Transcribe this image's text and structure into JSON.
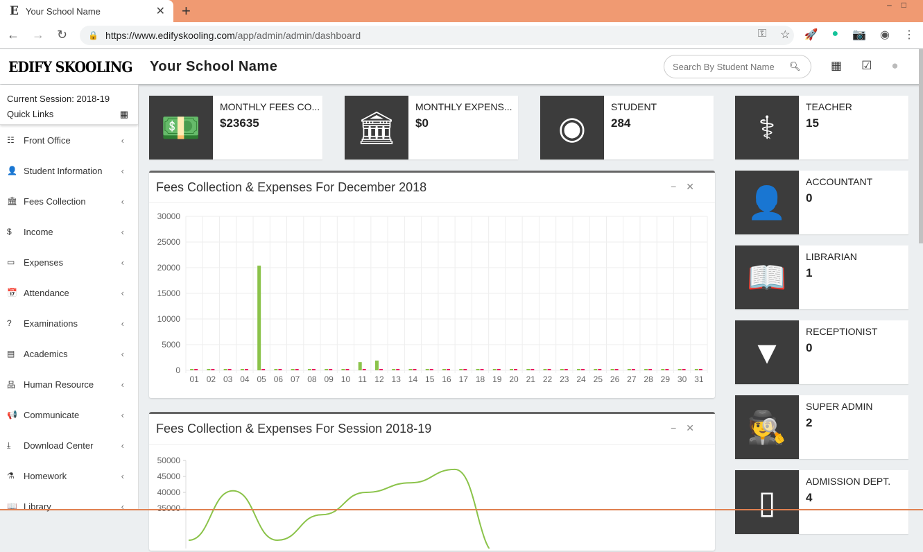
{
  "browser": {
    "tab_title": "Your School Name",
    "tab_logo": "E",
    "url_host": "https://www.edifyskooling.com",
    "url_path": "/app/admin/admin/dashboard",
    "icons": [
      "back-icon",
      "forward-icon",
      "reload-icon",
      "lock-icon",
      "key-icon",
      "star-icon",
      "rocket-icon",
      "grammarly-icon",
      "camera-icon",
      "profile-icon",
      "menu-icon"
    ]
  },
  "header": {
    "brand": "EDIFY SKOOLING",
    "school_name": "Your School Name",
    "search_placeholder": "Search By Student Name",
    "icons": [
      "search-icon",
      "calendar-icon",
      "checkbox-icon",
      "user-icon"
    ]
  },
  "sidebar": {
    "session": "Current Session: 2018-19",
    "quick_links": "Quick Links",
    "items": [
      {
        "label": "Front Office",
        "icon": "building-icon",
        "glyph": "☷"
      },
      {
        "label": "Student Information",
        "icon": "user-plus-icon",
        "glyph": "👤"
      },
      {
        "label": "Fees Collection",
        "icon": "bank-icon",
        "glyph": "🏛"
      },
      {
        "label": "Income",
        "icon": "dollar-icon",
        "glyph": "$"
      },
      {
        "label": "Expenses",
        "icon": "credit-card-icon",
        "glyph": "▭"
      },
      {
        "label": "Attendance",
        "icon": "calendar-check-icon",
        "glyph": "📅"
      },
      {
        "label": "Examinations",
        "icon": "question-icon",
        "glyph": "?"
      },
      {
        "label": "Academics",
        "icon": "id-card-icon",
        "glyph": "▤"
      },
      {
        "label": "Human Resource",
        "icon": "sitemap-icon",
        "glyph": "品"
      },
      {
        "label": "Communicate",
        "icon": "bullhorn-icon",
        "glyph": "📢"
      },
      {
        "label": "Download Center",
        "icon": "download-icon",
        "glyph": "⤓"
      },
      {
        "label": "Homework",
        "icon": "flask-icon",
        "glyph": "⚗"
      },
      {
        "label": "Library",
        "icon": "book-icon",
        "glyph": "📖"
      }
    ]
  },
  "stats": [
    {
      "label": "MONTHLY FEES CO...",
      "value": "$23635",
      "icon": "money-icon",
      "glyph": "💵"
    },
    {
      "label": "MONTHLY EXPENS...",
      "value": "$0",
      "icon": "bank-icon",
      "glyph": "🏛"
    },
    {
      "label": "STUDENT",
      "value": "284",
      "icon": "user-circle-icon",
      "glyph": "◉"
    }
  ],
  "roles": [
    {
      "label": "TEACHER",
      "value": "15",
      "icon": "doctor-icon",
      "glyph": "⚕"
    },
    {
      "label": "ACCOUNTANT",
      "value": "0",
      "icon": "user-icon",
      "glyph": "👤"
    },
    {
      "label": "LIBRARIAN",
      "value": "1",
      "icon": "book-icon",
      "glyph": "📖"
    },
    {
      "label": "RECEPTIONIST",
      "value": "0",
      "icon": "tie-icon",
      "glyph": "▼"
    },
    {
      "label": "SUPER ADMIN",
      "value": "2",
      "icon": "user-secret-icon",
      "glyph": "🕵"
    },
    {
      "label": "ADMISSION DEPT.",
      "value": "4",
      "icon": "door-icon",
      "glyph": "▯"
    }
  ],
  "chart_data": [
    {
      "type": "bar",
      "title": "Fees Collection & Expenses For December 2018",
      "categories": [
        "01",
        "02",
        "03",
        "04",
        "05",
        "06",
        "07",
        "08",
        "09",
        "10",
        "11",
        "12",
        "13",
        "14",
        "15",
        "16",
        "17",
        "18",
        "19",
        "20",
        "21",
        "22",
        "23",
        "24",
        "25",
        "26",
        "27",
        "28",
        "29",
        "30",
        "31"
      ],
      "series": [
        {
          "color": "#8bc34a",
          "values": [
            0,
            0,
            0,
            0,
            20400,
            0,
            0,
            0,
            0,
            0,
            1600,
            1900,
            0,
            0,
            0,
            0,
            0,
            0,
            0,
            0,
            0,
            0,
            0,
            0,
            0,
            0,
            0,
            0,
            0,
            0,
            0
          ]
        },
        {
          "color": "#e91e63",
          "values": [
            0,
            0,
            0,
            0,
            0,
            0,
            0,
            0,
            0,
            0,
            0,
            0,
            0,
            0,
            0,
            0,
            0,
            0,
            0,
            0,
            0,
            0,
            0,
            0,
            0,
            0,
            0,
            0,
            0,
            0,
            0
          ]
        }
      ],
      "ylim": [
        0,
        30000
      ],
      "yticks": [
        0,
        5000,
        10000,
        15000,
        20000,
        25000,
        30000
      ],
      "grid": true
    },
    {
      "type": "line",
      "title": "Fees Collection & Expenses For Session 2018-19",
      "series": [
        {
          "color": "#8bc34a",
          "values": [
            25000,
            40500,
            25000,
            33000,
            40000,
            43000,
            47200,
            20000
          ]
        }
      ],
      "ylim": [
        35000,
        50000
      ],
      "yticks": [
        35000,
        40000,
        45000,
        50000
      ],
      "grid": true
    }
  ]
}
